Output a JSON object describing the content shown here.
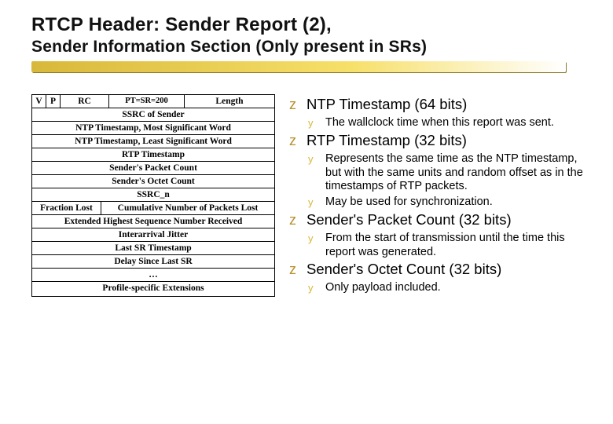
{
  "title": {
    "line1": "RTCP Header: Sender Report (2),",
    "line2": "Sender Information Section (Only present in SRs)"
  },
  "packet": {
    "hdr": {
      "v": "V",
      "p": "P",
      "rc": "RC",
      "pt": "PT=SR=200",
      "len": "Length"
    },
    "rows": {
      "ssrc": "SSRC of Sender",
      "ntp_msw": "NTP Timestamp, Most Significant Word",
      "ntp_lsw": "NTP Timestamp, Least Significant Word",
      "rtp_ts": "RTP Timestamp",
      "spc": "Sender's Packet Count",
      "soc": "Sender's Octet Count",
      "ssrc_n": "SSRC_n",
      "fl": "Fraction Lost",
      "cnpl": "Cumulative Number of Packets Lost",
      "ehsnr": "Extended Highest Sequence Number Received",
      "jitter": "Interarrival Jitter",
      "lsr": "Last SR Timestamp",
      "dlsr": "Delay Since Last SR",
      "ellipsis": "…",
      "pse": "Profile-specific Extensions"
    }
  },
  "notes": {
    "b1": "NTP Timestamp (64 bits)",
    "b1s1": "The wallclock time when this report was sent.",
    "b2": "RTP Timestamp (32 bits)",
    "b2s1": "Represents the same time as the NTP timestamp, but with the same units and random offset as in the timestamps of RTP packets.",
    "b2s2": "May be used for synchronization.",
    "b3": "Sender's Packet Count (32 bits)",
    "b3s1": "From the start of transmission until the time this report was generated.",
    "b4": "Sender's Octet Count (32 bits)",
    "b4s1": "Only payload included."
  },
  "bullets": {
    "l1": "z",
    "l2": "y"
  }
}
